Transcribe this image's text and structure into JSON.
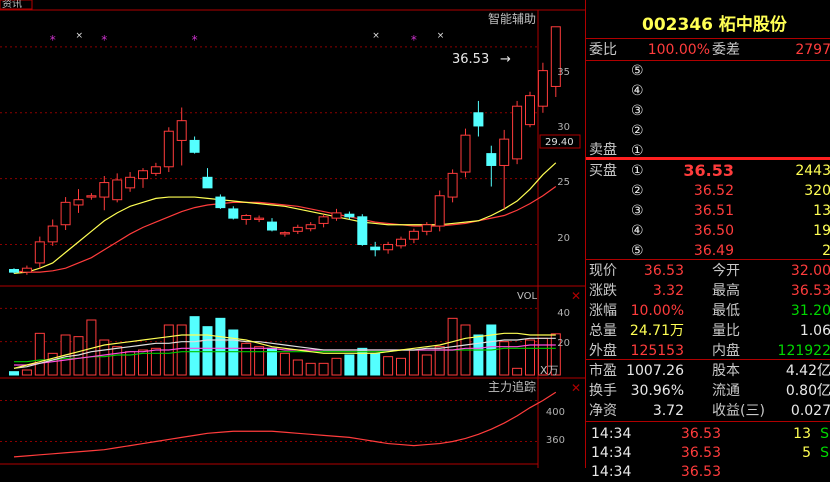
{
  "colors": {
    "up": "#ff3c3c",
    "down": "#54ffff",
    "ma5": "#ffff54",
    "ma10": "#ff3c3c",
    "ma20": "#ff4de0",
    "ma30": "#00c800",
    "grid": "#8b0000",
    "star": "#cc33cc"
  },
  "top_left_tab": "资讯",
  "main_chart": {
    "indicator_label": "智能辅助",
    "y_ticks": [
      "35",
      "30",
      "25",
      "20"
    ],
    "current_price_box": "29.40",
    "high_label": "36.53"
  },
  "vol_chart": {
    "label": "VOL",
    "y_ticks": [
      "40",
      "20"
    ],
    "unit": "X万"
  },
  "track_chart": {
    "label": "主力追踪",
    "y_ticks": [
      "400",
      "360"
    ]
  },
  "chart_data": {
    "type": "candlestick",
    "candles": [
      {
        "o": 18.1,
        "h": 18.2,
        "l": 17.8,
        "c": 17.9,
        "v": 2.0
      },
      {
        "o": 17.9,
        "h": 18.4,
        "l": 17.7,
        "c": 18.2,
        "v": 3.0
      },
      {
        "o": 18.6,
        "h": 20.6,
        "l": 18.2,
        "c": 20.2,
        "v": 25.0
      },
      {
        "o": 20.2,
        "h": 21.9,
        "l": 19.9,
        "c": 21.4,
        "v": 13.0
      },
      {
        "o": 21.5,
        "h": 23.6,
        "l": 21.1,
        "c": 23.2,
        "v": 24.0
      },
      {
        "o": 23.0,
        "h": 24.2,
        "l": 22.4,
        "c": 23.4,
        "v": 23.0
      },
      {
        "o": 23.6,
        "h": 23.9,
        "l": 23.4,
        "c": 23.7,
        "v": 33.0
      },
      {
        "o": 23.6,
        "h": 25.2,
        "l": 22.6,
        "c": 24.7,
        "v": 21.0
      },
      {
        "o": 23.4,
        "h": 25.4,
        "l": 23.2,
        "c": 24.9,
        "v": 17.0
      },
      {
        "o": 24.3,
        "h": 25.5,
        "l": 24.0,
        "c": 25.1,
        "v": 14.0
      },
      {
        "o": 25.0,
        "h": 25.8,
        "l": 24.3,
        "c": 25.6,
        "v": 15.0
      },
      {
        "o": 25.4,
        "h": 26.2,
        "l": 25.2,
        "c": 25.9,
        "v": 16.0
      },
      {
        "o": 25.9,
        "h": 28.9,
        "l": 25.5,
        "c": 28.6,
        "v": 30.0
      },
      {
        "o": 27.9,
        "h": 30.4,
        "l": 26.0,
        "c": 29.4,
        "v": 30.0
      },
      {
        "o": 27.9,
        "h": 28.2,
        "l": 26.9,
        "c": 27.0,
        "v": 35.0
      },
      {
        "o": 25.1,
        "h": 25.8,
        "l": 24.3,
        "c": 24.3,
        "v": 29.0
      },
      {
        "o": 23.6,
        "h": 23.8,
        "l": 22.7,
        "c": 22.8,
        "v": 34.0
      },
      {
        "o": 22.7,
        "h": 22.9,
        "l": 21.9,
        "c": 22.0,
        "v": 27.0
      },
      {
        "o": 21.9,
        "h": 22.3,
        "l": 21.5,
        "c": 22.2,
        "v": 19.0
      },
      {
        "o": 21.9,
        "h": 22.2,
        "l": 21.7,
        "c": 22.0,
        "v": 17.0
      },
      {
        "o": 21.7,
        "h": 22.0,
        "l": 21.0,
        "c": 21.1,
        "v": 16.0
      },
      {
        "o": 20.8,
        "h": 21.0,
        "l": 20.6,
        "c": 20.9,
        "v": 13.0
      },
      {
        "o": 21.0,
        "h": 21.5,
        "l": 20.8,
        "c": 21.3,
        "v": 9.0
      },
      {
        "o": 21.2,
        "h": 21.7,
        "l": 21.0,
        "c": 21.5,
        "v": 7.0
      },
      {
        "o": 21.6,
        "h": 22.3,
        "l": 21.3,
        "c": 22.1,
        "v": 7.0
      },
      {
        "o": 22.0,
        "h": 22.7,
        "l": 21.8,
        "c": 22.4,
        "v": 10.0
      },
      {
        "o": 22.3,
        "h": 22.5,
        "l": 21.9,
        "c": 22.1,
        "v": 12.0
      },
      {
        "o": 22.1,
        "h": 22.3,
        "l": 19.9,
        "c": 20.0,
        "v": 16.0
      },
      {
        "o": 19.8,
        "h": 20.2,
        "l": 19.1,
        "c": 19.6,
        "v": 13.0
      },
      {
        "o": 19.6,
        "h": 20.2,
        "l": 19.3,
        "c": 20.0,
        "v": 11.0
      },
      {
        "o": 19.9,
        "h": 20.6,
        "l": 19.7,
        "c": 20.4,
        "v": 10.0
      },
      {
        "o": 20.4,
        "h": 21.2,
        "l": 20.1,
        "c": 21.0,
        "v": 15.0
      },
      {
        "o": 21.0,
        "h": 21.7,
        "l": 20.7,
        "c": 21.5,
        "v": 12.0
      },
      {
        "o": 21.4,
        "h": 24.1,
        "l": 21.0,
        "c": 23.7,
        "v": 17.0
      },
      {
        "o": 23.6,
        "h": 25.7,
        "l": 23.2,
        "c": 25.4,
        "v": 34.0
      },
      {
        "o": 25.5,
        "h": 28.8,
        "l": 25.1,
        "c": 28.3,
        "v": 30.0
      },
      {
        "o": 30.0,
        "h": 30.9,
        "l": 28.2,
        "c": 29.0,
        "v": 24.0
      },
      {
        "o": 26.9,
        "h": 27.5,
        "l": 24.4,
        "c": 26.0,
        "v": 30.0
      },
      {
        "o": 26.0,
        "h": 28.7,
        "l": 22.7,
        "c": 28.0,
        "v": 20.0
      },
      {
        "o": 26.5,
        "h": 30.9,
        "l": 26.1,
        "c": 30.5,
        "v": 4.0
      },
      {
        "o": 29.1,
        "h": 31.6,
        "l": 28.9,
        "c": 31.3,
        "v": 21.0
      },
      {
        "o": 30.5,
        "h": 33.8,
        "l": 30.0,
        "c": 33.2,
        "v": 22.0
      },
      {
        "o": 32.0,
        "h": 36.53,
        "l": 31.2,
        "c": 36.53,
        "v": 24.7
      }
    ],
    "ma5": [
      17.8,
      17.9,
      18.2,
      18.6,
      19.4,
      20.2,
      21.0,
      21.8,
      22.4,
      22.9,
      23.2,
      23.5,
      23.6,
      23.6,
      23.6,
      23.5,
      23.4,
      23.3,
      23.2,
      23.1,
      23.0,
      22.9,
      22.7,
      22.5,
      22.3,
      22.1,
      21.9,
      21.7,
      21.6,
      21.5,
      21.5,
      21.5,
      21.5,
      21.5,
      21.6,
      21.7,
      21.8,
      22.2,
      22.7,
      23.3,
      24.2,
      25.3,
      26.2
    ],
    "ma10": [
      18.0,
      17.9,
      17.9,
      18.0,
      18.2,
      18.6,
      19.0,
      19.6,
      20.2,
      20.8,
      21.3,
      21.7,
      22.1,
      22.5,
      22.8,
      23.0,
      23.1,
      23.2,
      23.2,
      23.2,
      23.1,
      23.0,
      22.9,
      22.7,
      22.5,
      22.3,
      22.1,
      21.9,
      21.7,
      21.6,
      21.5,
      21.4,
      21.4,
      21.4,
      21.5,
      21.6,
      21.8,
      22.0,
      22.2,
      22.6,
      23.1,
      23.7,
      24.4
    ],
    "vol_ma5": [
      4,
      6,
      8,
      10,
      12,
      14,
      16,
      18,
      19,
      20,
      21,
      22,
      23,
      24,
      24,
      24,
      23,
      22,
      21,
      19,
      17,
      16,
      15,
      14,
      13,
      13,
      13,
      13,
      13,
      14,
      15,
      16,
      17,
      18,
      20,
      22,
      23,
      24,
      25,
      25,
      24,
      24,
      24
    ],
    "vol_ma10": [
      4,
      5,
      7,
      9,
      11,
      12,
      14,
      15,
      16,
      17,
      18,
      19,
      19,
      20,
      20,
      21,
      21,
      21,
      20,
      20,
      19,
      18,
      17,
      16,
      15,
      15,
      15,
      15,
      15,
      15,
      15,
      15,
      16,
      16,
      17,
      18,
      19,
      20,
      21,
      21,
      22,
      22,
      22
    ],
    "vol_ma20": [
      6,
      6,
      7,
      8,
      9,
      10,
      11,
      12,
      13,
      14,
      14,
      15,
      15,
      16,
      16,
      16,
      16,
      16,
      16,
      16,
      16,
      15,
      15,
      15,
      15,
      15,
      15,
      15,
      15,
      15,
      15,
      15,
      15,
      15,
      15,
      16,
      16,
      17,
      17,
      17,
      18,
      18,
      18
    ],
    "vol_ma30": [
      8,
      8,
      9,
      9,
      10,
      10,
      11,
      11,
      12,
      12,
      13,
      13,
      13,
      14,
      14,
      14,
      14,
      14,
      14,
      14,
      14,
      14,
      14,
      14,
      14,
      14,
      14,
      14,
      14,
      14,
      15,
      15,
      15,
      15,
      15,
      15,
      15,
      15,
      16,
      16,
      16,
      16,
      16
    ],
    "track": [
      345,
      346,
      347,
      348,
      349,
      350,
      351,
      352,
      354,
      356,
      358,
      360,
      362,
      364,
      366,
      368,
      369,
      370,
      370,
      370,
      370,
      369,
      368,
      367,
      366,
      365,
      364,
      362,
      360,
      358,
      357,
      356,
      357,
      358,
      360,
      363,
      367,
      372,
      378,
      385,
      393,
      400,
      408
    ],
    "main_ylim": [
      17.0,
      37.5
    ],
    "vol_ylim": [
      0,
      45
    ],
    "track_ylim": [
      340,
      420
    ]
  },
  "quote": {
    "code_name": "002346  柘中股份",
    "weibi_label": "委比",
    "weibi_value": "100.00%",
    "weicha_label": "委差",
    "weicha_value": "2797",
    "sell_label": "卖盘",
    "buy_label": "买盘",
    "sell_levels": [
      {
        "n": "⑤"
      },
      {
        "n": "④"
      },
      {
        "n": "③"
      },
      {
        "n": "②"
      },
      {
        "n": "①"
      }
    ],
    "buy_levels": [
      {
        "n": "①",
        "price": "36.53",
        "vol": "2443"
      },
      {
        "n": "②",
        "price": "36.52",
        "vol": "320"
      },
      {
        "n": "③",
        "price": "36.51",
        "vol": "13"
      },
      {
        "n": "④",
        "price": "36.50",
        "vol": "19"
      },
      {
        "n": "⑤",
        "price": "36.49",
        "vol": "2"
      }
    ],
    "stats": [
      {
        "l1": "现价",
        "v1": "36.53",
        "l2": "今开",
        "v2": "32.00"
      },
      {
        "l1": "涨跌",
        "v1": "3.32",
        "l2": "最高",
        "v2": "36.53"
      },
      {
        "l1": "涨幅",
        "v1": "10.00%",
        "l2": "最低",
        "v2": "31.20"
      },
      {
        "l1": "总量",
        "v1": "24.71万",
        "l2": "量比",
        "v2": "1.06"
      },
      {
        "l1": "外盘",
        "v1": "125153",
        "l2": "内盘",
        "v2": "121922"
      }
    ],
    "stats2": [
      {
        "l1": "市盈",
        "v1": "1007.26",
        "l2": "股本",
        "v2": "4.42亿"
      },
      {
        "l1": "换手",
        "v1": "30.96%",
        "l2": "流通",
        "v2": "0.80亿"
      },
      {
        "l1": "净资",
        "v1": "3.72",
        "l2": "收益(三)",
        "v2": "0.027"
      }
    ],
    "ticks": [
      {
        "time": "14:34",
        "price": "36.53",
        "vol": "13",
        "side": "S"
      },
      {
        "time": "14:34",
        "price": "36.53",
        "vol": "5",
        "side": "S"
      },
      {
        "time": "14:34",
        "price": "36.53",
        "vol": "",
        "side": ""
      }
    ]
  }
}
